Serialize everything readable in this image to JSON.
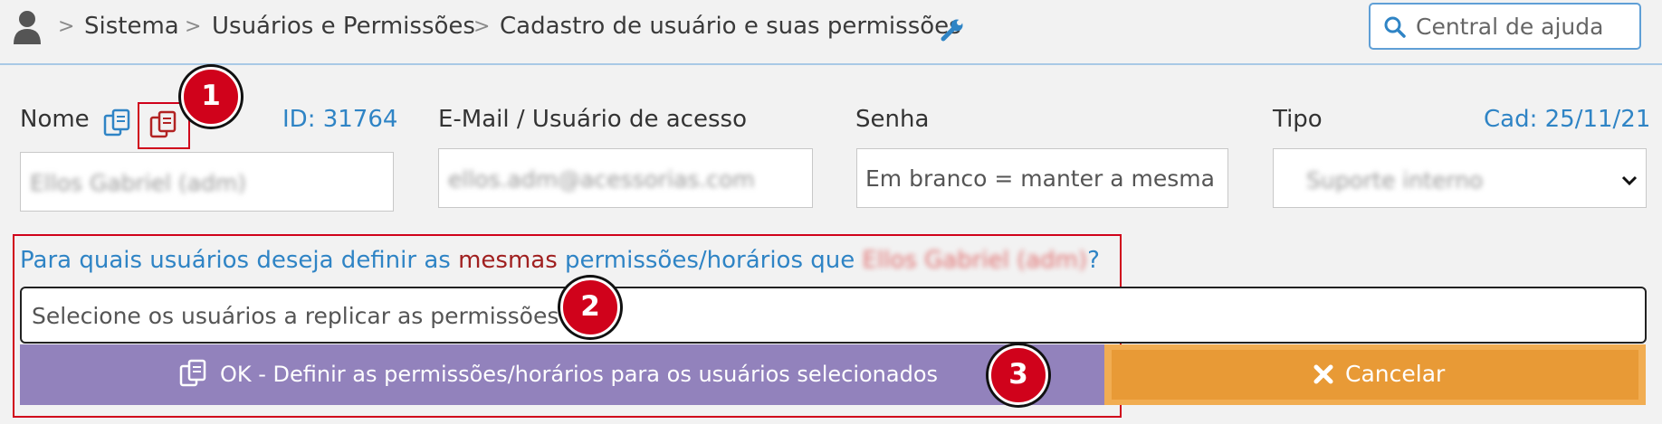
{
  "breadcrumb": {
    "items": [
      "Sistema",
      "Usuários e Permissões",
      "Cadastro de usuário e suas permissões"
    ],
    "user_icon": "user-icon",
    "settings_icon": "wrench-icon"
  },
  "search": {
    "label": "Central de ajuda",
    "icon": "search-icon"
  },
  "form": {
    "nome_label": "Nome",
    "id_text": "ID: 31764",
    "nome_value": "Ellos Gabriel (adm)",
    "email_label": "E-Mail / Usuário de acesso",
    "email_value": "ellos.adm@acessorias.com",
    "senha_label": "Senha",
    "senha_placeholder": "Em branco = manter a mesma",
    "tipo_label": "Tipo",
    "cad_text": "Cad: 25/11/21",
    "tipo_value": "Suporte interno"
  },
  "replicate": {
    "question_prefix": "Para quais usuários deseja definir as ",
    "question_highlight": "mesmas",
    "question_middle": " permissões/horários que ",
    "question_user": "Ellos Gabriel (adm)",
    "question_suffix": "?",
    "select_placeholder": "Selecione os usuários a replicar as permissões",
    "ok_label": "OK - Definir as permissões/horários para os usuários selecionados",
    "cancel_label": "Cancelar"
  },
  "annotations": {
    "badge1": "1",
    "badge2": "2",
    "badge3": "3"
  },
  "colors": {
    "accent_blue": "#2f84c5",
    "highlight_red": "#a02020",
    "ok_button": "#9282bc",
    "cancel_button": "#e89a36",
    "annotation_red": "#d0021b"
  }
}
